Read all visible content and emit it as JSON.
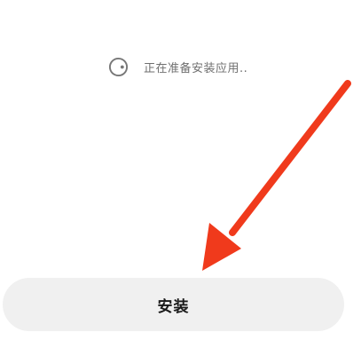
{
  "status": {
    "icon": "loading-spinner-icon",
    "text": "正在准备安装应用.."
  },
  "install_button": {
    "label": "安装"
  },
  "annotation": {
    "icon": "red-arrow-icon",
    "color": "#f03a1c"
  },
  "colors": {
    "background": "#ffffff",
    "button_background": "#f0f0f0",
    "status_text": "#6f6f6f",
    "button_text": "#1a1a1a"
  }
}
